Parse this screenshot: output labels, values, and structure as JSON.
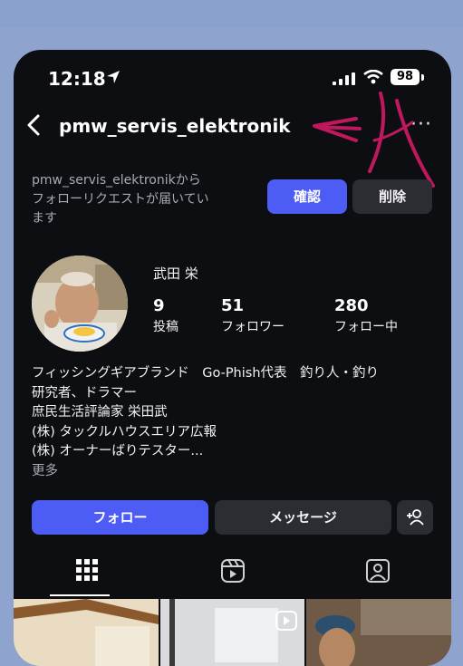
{
  "status_bar": {
    "time": "12:18",
    "battery": "98"
  },
  "header": {
    "username": "pmw_servis_elektronik"
  },
  "follow_request": {
    "line1": "pmw_servis_elektronikから",
    "line2": "フォローリクエストが届いてい",
    "line3": "ます",
    "confirm_label": "確認",
    "delete_label": "削除"
  },
  "profile": {
    "display_name": "武田 栄",
    "stats": [
      {
        "value": "9",
        "label": "投稿"
      },
      {
        "value": "51",
        "label": "フォロワー"
      },
      {
        "value": "280",
        "label": "フォロー中"
      }
    ],
    "bio_lines": [
      "フィッシングギアブランド　Go-Phish代表　釣り人・釣り",
      "研究者、ドラマー",
      "庶民生活評論家 栄田武",
      "(株) タックルハウスエリア広報",
      "(株) オーナーばりテスター..."
    ],
    "more_label": "更多"
  },
  "actions": {
    "follow_label": "フォロー",
    "message_label": "メッセージ"
  },
  "tabs": [
    {
      "icon": "grid-icon",
      "selected": true
    },
    {
      "icon": "reels-icon",
      "selected": false
    },
    {
      "icon": "tagged-icon",
      "selected": false
    }
  ],
  "colors": {
    "background": "#0d0e12",
    "accent_blue": "#4c5cf5",
    "secondary_button": "#2b2d33",
    "annotation_magenta": "#c0185e",
    "outer_background": "#8ea4cf"
  }
}
